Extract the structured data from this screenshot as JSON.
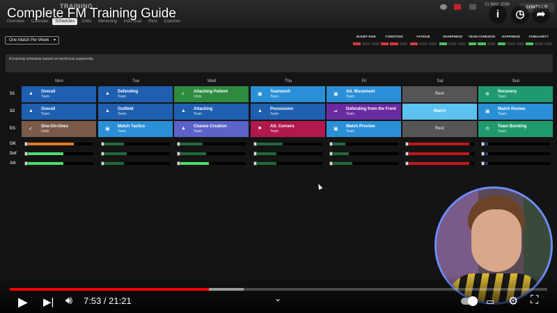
{
  "video": {
    "title": "Complete FM Training Guide",
    "time": "7:53 / 21:21",
    "played_fraction": 0.37,
    "buffered_fraction": 0.435
  },
  "fm": {
    "section": "TRAINING",
    "date": "21 MAY 2036",
    "continue_label": "CONTINUE",
    "tabs": [
      "Overview",
      "Calendar",
      "Schedules",
      "Units",
      "Mentoring",
      "Individual",
      "Rest",
      "Coaches"
    ],
    "active_tab": "Schedules",
    "schedule_select": "One Match Per Week",
    "description": "A training schedule based on technical superiority.",
    "metrics": [
      {
        "label": "INJURY RISK",
        "color": "#d83a3a",
        "level": 1
      },
      {
        "label": "CONDITION",
        "color": "#d83a3a",
        "level": 2
      },
      {
        "label": "FATIGUE",
        "color": "#d83a3a",
        "level": 1
      },
      {
        "label": "SHARPNESS",
        "color": "#4fbf5a",
        "level": 1
      },
      {
        "label": "TEAM COHESION",
        "color": "#4fbf5a",
        "level": 2
      },
      {
        "label": "HAPPINESS",
        "color": "#4fbf5a",
        "level": 1
      },
      {
        "label": "FAMILIARITY",
        "color": "#4fbf5a",
        "level": 1
      }
    ],
    "days": [
      "Mon",
      "Tue",
      "Wed",
      "Thu",
      "Fri",
      "Sat",
      "Sun"
    ],
    "sessions": [
      {
        "label": "S1",
        "cells": [
          {
            "name": "Overall",
            "sub": "Team",
            "color": "#1f5fb0",
            "icon": "cone-icon",
            "glyph": "▲"
          },
          {
            "name": "Defending",
            "sub": "Team",
            "color": "#1f5fb0",
            "icon": "cone-icon",
            "glyph": "▲"
          },
          {
            "name": "Attacking Patient",
            "sub": "Units",
            "color": "#2e8a3e",
            "icon": "runner-icon",
            "glyph": "✧"
          },
          {
            "name": "Teamwork",
            "sub": "Team",
            "color": "#2a8fd6",
            "icon": "clipboard-icon",
            "glyph": "▣"
          },
          {
            "name": "Att. Movement",
            "sub": "Team",
            "color": "#2a8fd6",
            "icon": "clipboard-icon",
            "glyph": "▣"
          },
          {
            "name": "Rest",
            "sub": "",
            "color": "#555555",
            "icon": "",
            "glyph": "",
            "center": true
          },
          {
            "name": "Recovery",
            "sub": "Team",
            "color": "#1f9a6e",
            "icon": "recovery-icon",
            "glyph": "⊕"
          }
        ]
      },
      {
        "label": "S2",
        "cells": [
          {
            "name": "Overall",
            "sub": "Team",
            "color": "#1f5fb0",
            "icon": "cone-icon",
            "glyph": "▲"
          },
          {
            "name": "Outfield",
            "sub": "Team",
            "color": "#1f5fb0",
            "icon": "cone-icon",
            "glyph": "▲"
          },
          {
            "name": "Attacking",
            "sub": "Team",
            "color": "#1f5fb0",
            "icon": "cone-icon",
            "glyph": "▲"
          },
          {
            "name": "Possession",
            "sub": "Team",
            "color": "#1f5fb0",
            "icon": "cone-icon",
            "glyph": "▲"
          },
          {
            "name": "Defending from the Front",
            "sub": "Team",
            "color": "#6a2aa0",
            "icon": "arrow-icon",
            "glyph": "➟"
          },
          {
            "name": "Match",
            "sub": "",
            "color": "#5cc2ee",
            "icon": "",
            "glyph": "",
            "center": true
          },
          {
            "name": "Match Review",
            "sub": "Team",
            "color": "#2a8fd6",
            "icon": "clipboard-icon",
            "glyph": "▣"
          }
        ]
      },
      {
        "label": "ES",
        "cells": [
          {
            "name": "One-On-Ones",
            "sub": "Units",
            "color": "#7a5a48",
            "icon": "whistle-icon",
            "glyph": "➶"
          },
          {
            "name": "Match Tactics",
            "sub": "Team",
            "color": "#2a8fd6",
            "icon": "clipboard-icon",
            "glyph": "▣"
          },
          {
            "name": "Chance Creation",
            "sub": "Team",
            "color": "#5b62c8",
            "icon": "cone-icon",
            "glyph": "▲"
          },
          {
            "name": "Att. Corners",
            "sub": "Team",
            "color": "#b0184e",
            "icon": "setpiece-icon",
            "glyph": "⚑"
          },
          {
            "name": "Match Preview",
            "sub": "Team",
            "color": "#2a8fd6",
            "icon": "clipboard-icon",
            "glyph": "▣"
          },
          {
            "name": "Rest",
            "sub": "",
            "color": "#555555",
            "icon": "",
            "glyph": "",
            "center": true
          },
          {
            "name": "Team Bonding",
            "sub": "Team",
            "color": "#1f9a6e",
            "icon": "bonding-icon",
            "glyph": "⟲"
          }
        ]
      }
    ],
    "load_rows": [
      {
        "label": "GK",
        "values": [
          {
            "level": 0.72,
            "color": "#e07a26"
          },
          {
            "level": 0.3,
            "color": "#1f6a3a"
          },
          {
            "level": 0.35,
            "color": "#1f6a3a"
          },
          {
            "level": 0.4,
            "color": "#1f6a3a"
          },
          {
            "level": 0.2,
            "color": "#1f6a3a"
          },
          {
            "level": 0.95,
            "color": "#c01818"
          },
          {
            "level": 0.05,
            "color": "#1f3a7a"
          }
        ]
      },
      {
        "label": "Def",
        "values": [
          {
            "level": 0.55,
            "color": "#4fdc6e"
          },
          {
            "level": 0.35,
            "color": "#1f6a3a"
          },
          {
            "level": 0.4,
            "color": "#1f6a3a"
          },
          {
            "level": 0.3,
            "color": "#1f6a3a"
          },
          {
            "level": 0.25,
            "color": "#1f6a3a"
          },
          {
            "level": 0.95,
            "color": "#c01818"
          },
          {
            "level": 0.05,
            "color": "#1f3a7a"
          }
        ]
      },
      {
        "label": "Att",
        "values": [
          {
            "level": 0.55,
            "color": "#4fdc6e"
          },
          {
            "level": 0.3,
            "color": "#1f6a3a"
          },
          {
            "level": 0.45,
            "color": "#4fdc6e"
          },
          {
            "level": 0.3,
            "color": "#1f6a3a"
          },
          {
            "level": 0.3,
            "color": "#1f6a3a"
          },
          {
            "level": 0.95,
            "color": "#c01818"
          },
          {
            "level": 0.05,
            "color": "#1f3a7a"
          }
        ]
      }
    ]
  }
}
